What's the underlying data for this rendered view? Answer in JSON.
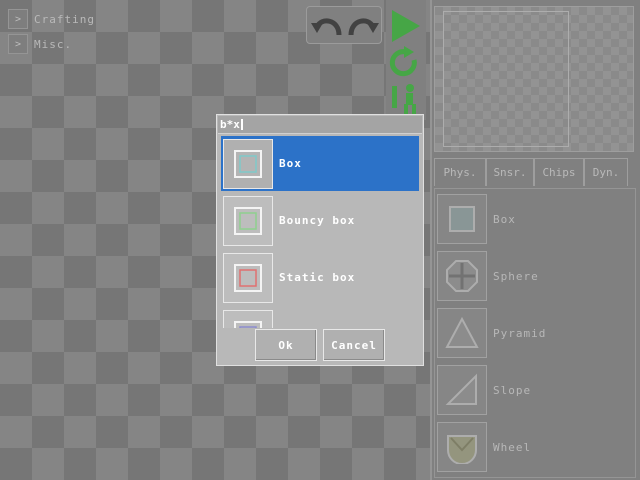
{
  "left_menu": {
    "categories": [
      {
        "arrow": ">",
        "label": "Crafting"
      },
      {
        "arrow": ">",
        "label": "Misc."
      }
    ]
  },
  "toolbar": {
    "undo_icon": "undo-arrow",
    "redo_icon": "redo-arrow",
    "play_icon": "play-triangle",
    "restart_icon": "restart-arrow",
    "character_icon": "walking-figure"
  },
  "right_panel": {
    "tabs": [
      {
        "label": "Phys."
      },
      {
        "label": "Snsr."
      },
      {
        "label": "Chips"
      },
      {
        "label": "Dyn."
      }
    ],
    "items": [
      {
        "label": "Box",
        "icon": "box-icon"
      },
      {
        "label": "Sphere",
        "icon": "sphere-icon"
      },
      {
        "label": "Pyramid",
        "icon": "pyramid-icon"
      },
      {
        "label": "Slope",
        "icon": "slope-icon"
      },
      {
        "label": "Wheel",
        "icon": "wheel-icon"
      }
    ]
  },
  "dialog": {
    "search_value": "b*x",
    "options": [
      {
        "label": "Box",
        "selected": true,
        "icon_color": "#7fc9c9"
      },
      {
        "label": "Bouncy box",
        "selected": false,
        "icon_color": "#8fd08f"
      },
      {
        "label": "Static box",
        "selected": false,
        "icon_color": "#e07070"
      }
    ],
    "ok_label": "Ok",
    "cancel_label": "Cancel"
  },
  "colors": {
    "selection": "#2c72c8",
    "accent_green": "#3fbf3f"
  }
}
